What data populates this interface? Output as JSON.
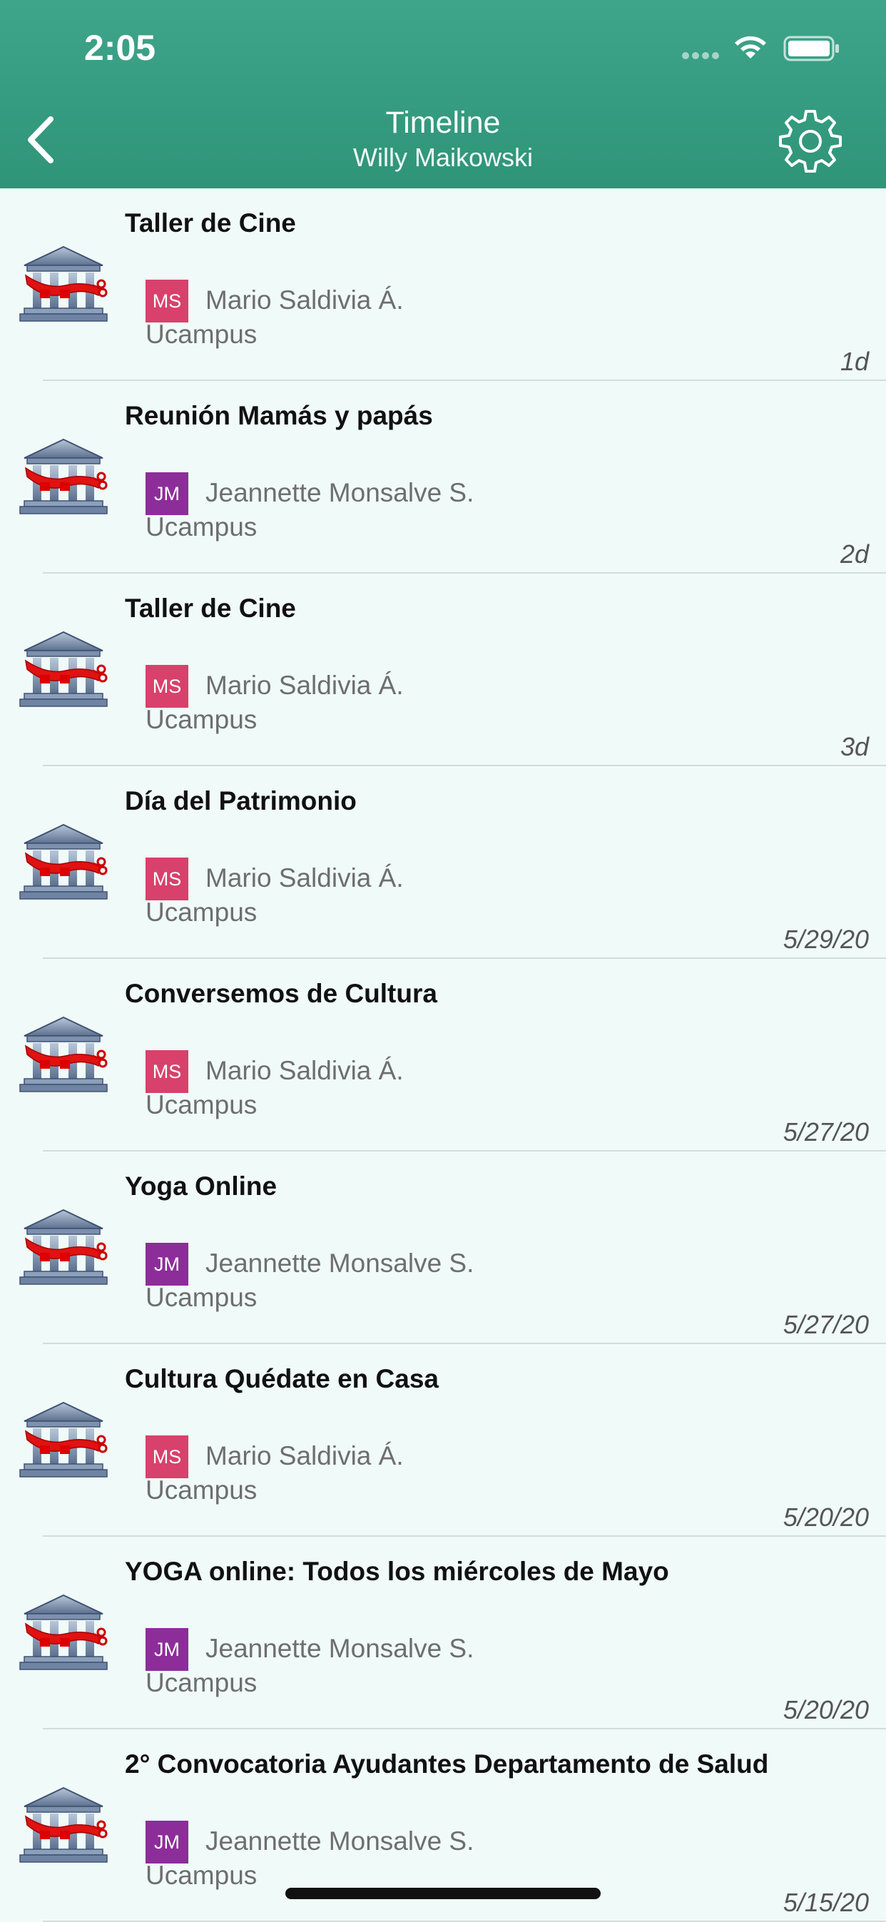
{
  "status_bar": {
    "time": "2:05"
  },
  "header": {
    "title": "Timeline",
    "subtitle": "Willy Maikowski"
  },
  "colors": {
    "header_green": "#3ea58b",
    "avatar_ms": "#d8416b",
    "avatar_jm": "#8d2d9a"
  },
  "timeline": [
    {
      "title": "Taller de Cine",
      "initials": "MS",
      "author": "Mario Saldivia Á.",
      "source": "Ucampus",
      "date": "1d",
      "avatar_color": "#d8416b"
    },
    {
      "title": "Reunión Mamás y papás",
      "initials": "JM",
      "author": "Jeannette Monsalve S.",
      "source": "Ucampus",
      "date": "2d",
      "avatar_color": "#8d2d9a"
    },
    {
      "title": "Taller de Cine",
      "initials": "MS",
      "author": "Mario Saldivia Á.",
      "source": "Ucampus",
      "date": "3d",
      "avatar_color": "#d8416b"
    },
    {
      "title": "Día del Patrimonio",
      "initials": "MS",
      "author": "Mario Saldivia Á.",
      "source": "Ucampus",
      "date": "5/29/20",
      "avatar_color": "#d8416b"
    },
    {
      "title": "Conversemos de Cultura",
      "initials": "MS",
      "author": "Mario Saldivia Á.",
      "source": "Ucampus",
      "date": "5/27/20",
      "avatar_color": "#d8416b"
    },
    {
      "title": "Yoga Online",
      "initials": "JM",
      "author": "Jeannette Monsalve S.",
      "source": "Ucampus",
      "date": "5/27/20",
      "avatar_color": "#8d2d9a"
    },
    {
      "title": "Cultura Quédate en Casa",
      "initials": "MS",
      "author": "Mario Saldivia Á.",
      "source": "Ucampus",
      "date": "5/20/20",
      "avatar_color": "#d8416b"
    },
    {
      "title": "YOGA online: Todos los miércoles de Mayo",
      "initials": "JM",
      "author": "Jeannette Monsalve S.",
      "source": "Ucampus",
      "date": "5/20/20",
      "avatar_color": "#8d2d9a"
    },
    {
      "title": "2° Convocatoria Ayudantes Departamento de Salud",
      "initials": "JM",
      "author": "Jeannette Monsalve S.",
      "source": "Ucampus",
      "date": "5/15/20",
      "avatar_color": "#8d2d9a"
    }
  ]
}
